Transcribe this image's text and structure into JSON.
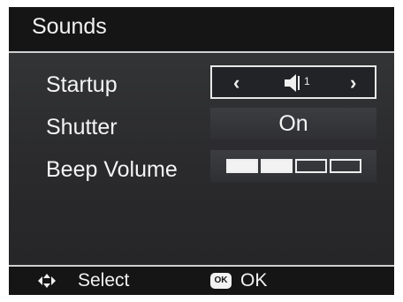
{
  "title": "Sounds",
  "rows": [
    {
      "label": "Startup",
      "value_icon": "speaker-icon",
      "value_number": "1"
    },
    {
      "label": "Shutter",
      "value": "On"
    },
    {
      "label": "Beep Volume",
      "volume_level": 2,
      "volume_max": 4
    }
  ],
  "footer": {
    "select_icon": "dpad-icon",
    "select_label": "Select",
    "ok_icon": "ok-button-icon",
    "ok_icon_text": "OK",
    "ok_label": "OK"
  }
}
